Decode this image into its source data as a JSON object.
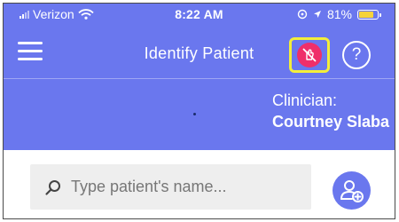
{
  "status_bar": {
    "carrier": "Verizon",
    "time": "8:22 AM",
    "battery": "81%",
    "battery_level": 0.81
  },
  "nav": {
    "title": "Identify Patient",
    "help_label": "?"
  },
  "clinician": {
    "label": "Clinician:",
    "name": "Courtney Slaba"
  },
  "search": {
    "placeholder": "Type patient's name..."
  },
  "icons": {
    "menu": "hamburger-menu-icon",
    "no_touch": "no-touch-hand-icon",
    "help": "question-mark-icon",
    "search": "search-icon",
    "add_patient": "add-user-icon"
  },
  "colors": {
    "primary": "#6a77ee",
    "highlight": "#f3ee3a",
    "alert": "#ef2f6a",
    "battery": "#f5d33a"
  }
}
